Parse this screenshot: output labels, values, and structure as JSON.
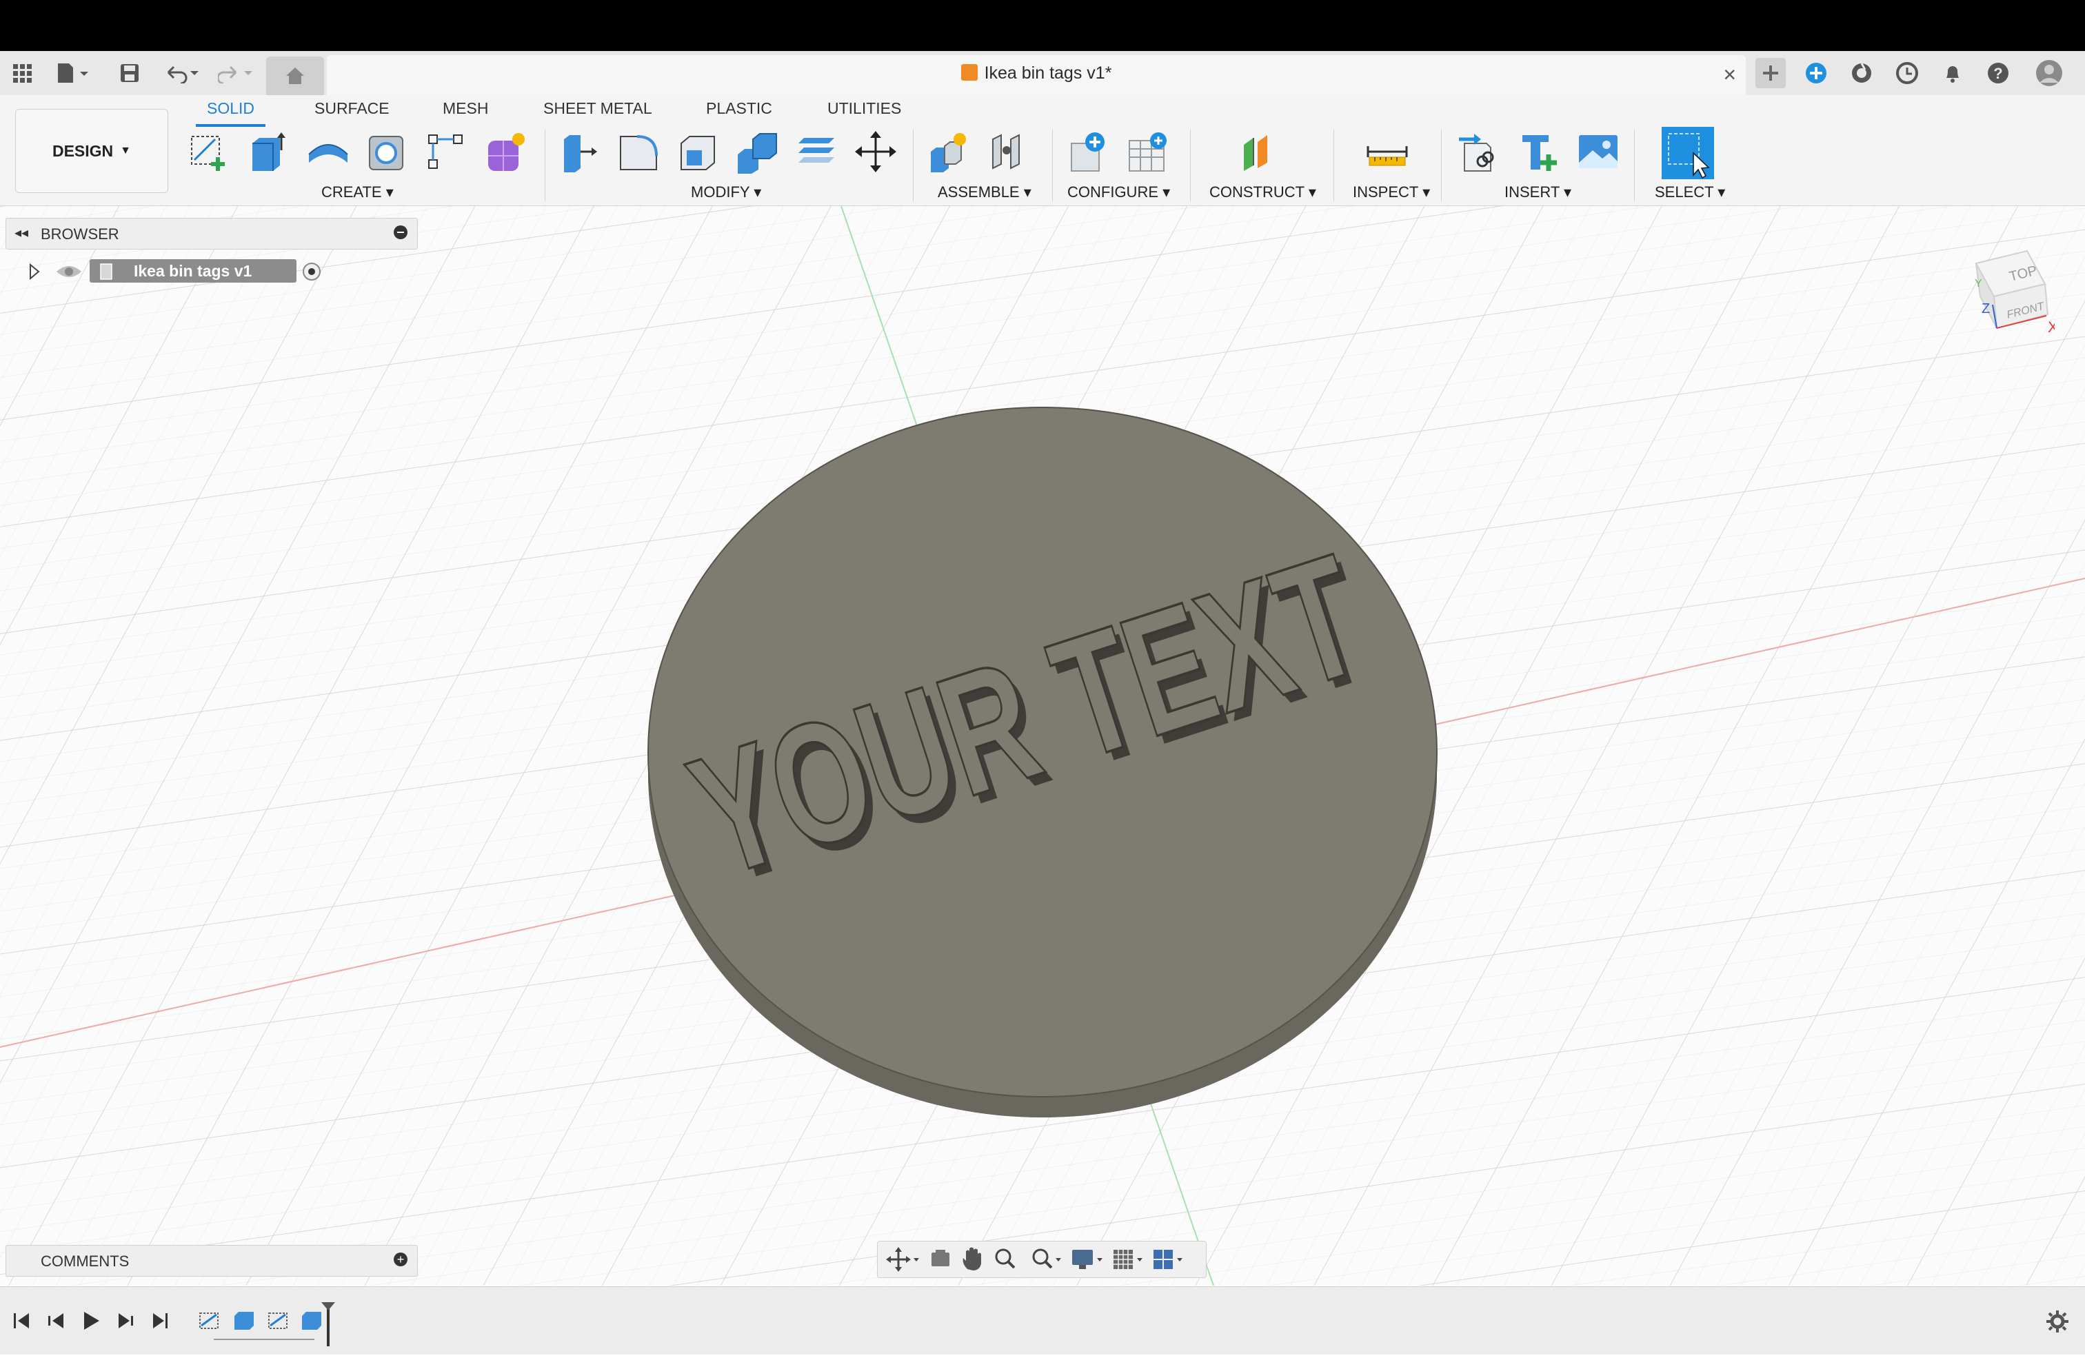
{
  "app": {
    "document_title": "Ikea bin tags v1*"
  },
  "workspace": {
    "design_label": "DESIGN"
  },
  "tabs": [
    {
      "label": "SOLID",
      "active": true
    },
    {
      "label": "SURFACE",
      "active": false
    },
    {
      "label": "MESH",
      "active": false
    },
    {
      "label": "SHEET METAL",
      "active": false
    },
    {
      "label": "PLASTIC",
      "active": false
    },
    {
      "label": "UTILITIES",
      "active": false
    }
  ],
  "groups": {
    "create": "CREATE",
    "modify": "MODIFY",
    "assemble": "ASSEMBLE",
    "configure": "CONFIGURE",
    "construct": "CONSTRUCT",
    "inspect": "INSPECT",
    "insert": "INSERT",
    "select": "SELECT"
  },
  "browser": {
    "title": "BROWSER",
    "root_item": "Ikea bin tags v1"
  },
  "comments": {
    "title": "COMMENTS"
  },
  "model": {
    "embossed_text": "YOUR TEXT"
  },
  "viewcube": {
    "top": "TOP",
    "front": "FRONT",
    "x_axis": "X",
    "z_axis": "Z",
    "y_axis": "Y"
  },
  "colors": {
    "accent": "#1f7fd6",
    "model_face": "#7e7b70",
    "model_edge": "#5e5c54"
  }
}
